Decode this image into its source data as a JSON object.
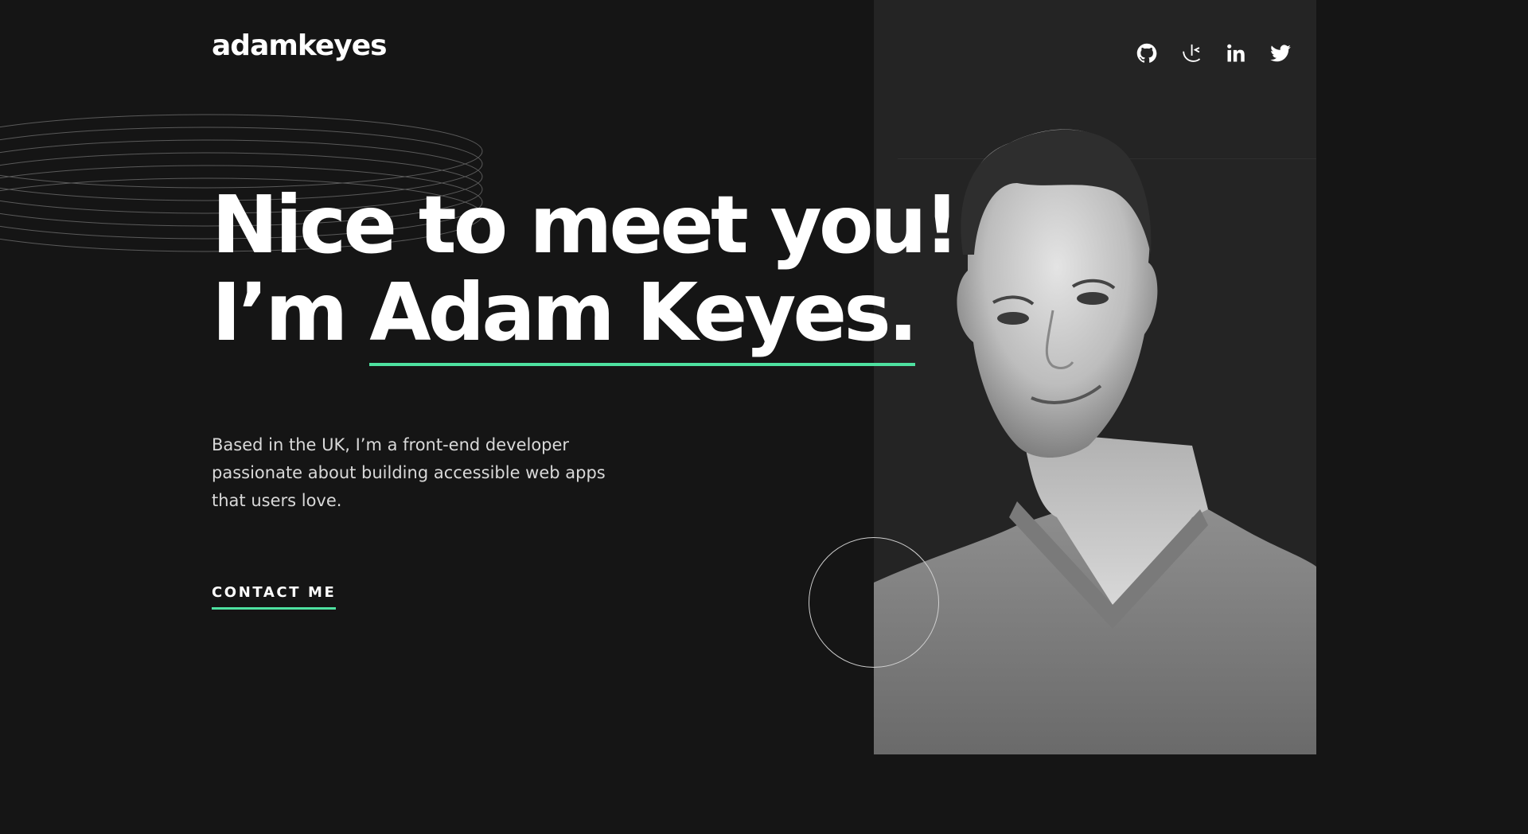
{
  "header": {
    "logo": "adamkeyes",
    "socials": [
      {
        "name": "GitHub",
        "icon": "github-icon"
      },
      {
        "name": "Frontend Mentor",
        "icon": "frontend-mentor-icon"
      },
      {
        "name": "LinkedIn",
        "icon": "linkedin-icon"
      },
      {
        "name": "Twitter",
        "icon": "twitter-icon"
      }
    ]
  },
  "hero": {
    "title_line1": "Nice to meet you!",
    "title_line2_prefix": "I’m ",
    "title_name": "Adam Keyes.",
    "intro": "Based in the UK, I’m a front-end developer passionate about building accessible web apps that users love.",
    "cta_label": "CONTACT ME"
  },
  "colors": {
    "background": "#151515",
    "panel": "#242424",
    "accent": "#4ee1a0",
    "text": "#ffffff",
    "muted_text": "#d9d9d9"
  }
}
